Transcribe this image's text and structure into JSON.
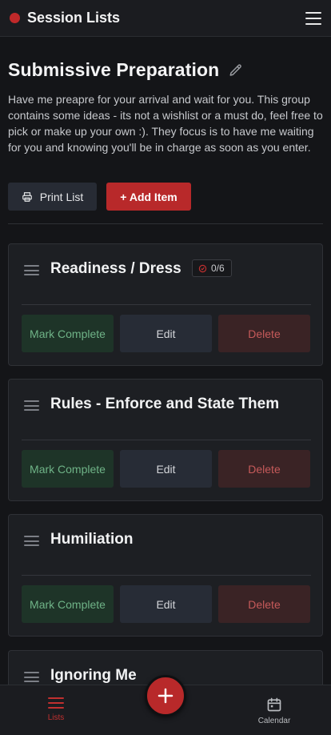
{
  "app": {
    "title": "Session Lists"
  },
  "list": {
    "title": "Submissive Preparation",
    "description": "Have me preapre for your arrival and wait for you. This group contains some ideas - its not a wishlist or a must do, feel free to pick or make up your own :). They focus is to have me waiting for you and knowing you'll be in charge as soon as you enter."
  },
  "actions": {
    "print_label": "Print List",
    "add_label": "+ Add Item"
  },
  "items": [
    {
      "title": "Readiness / Dress",
      "progress": "0/6",
      "mark_label": "Mark Complete",
      "edit_label": "Edit",
      "delete_label": "Delete"
    },
    {
      "title": "Rules - Enforce and State Them",
      "mark_label": "Mark Complete",
      "edit_label": "Edit",
      "delete_label": "Delete"
    },
    {
      "title": "Humiliation",
      "mark_label": "Mark Complete",
      "edit_label": "Edit",
      "delete_label": "Delete"
    },
    {
      "title": "Ignoring Me"
    }
  ],
  "nav": {
    "lists_label": "Lists",
    "calendar_label": "Calendar",
    "fab_label": "+"
  },
  "colors": {
    "accent": "#b8292a",
    "background": "#141518",
    "card": "#1d1f23"
  }
}
